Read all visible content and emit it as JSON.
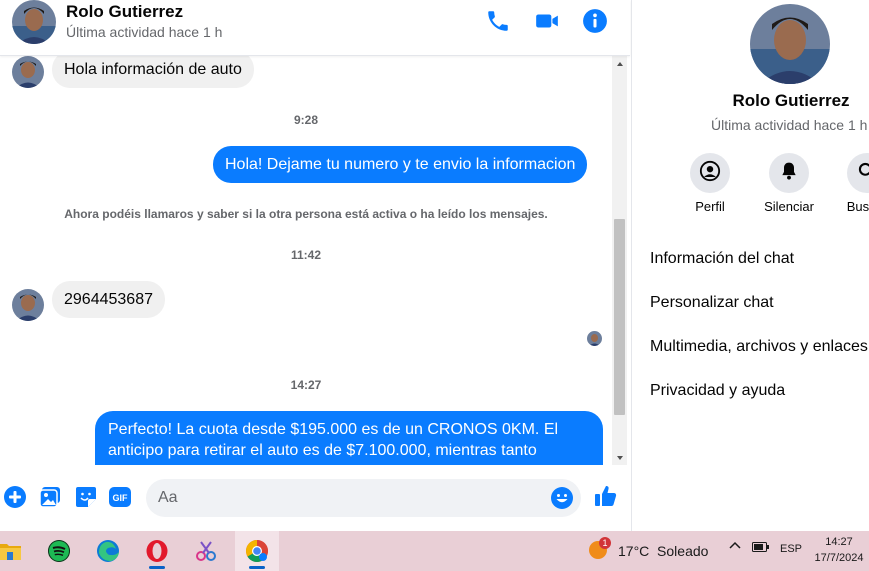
{
  "header": {
    "name": "Rolo Gutierrez",
    "status": "Última actividad hace 1 h",
    "icons": [
      "phone-icon",
      "video-camera-icon",
      "info-icon"
    ]
  },
  "messages": [
    {
      "type": "in",
      "text": "Hola información de auto"
    },
    {
      "type": "time",
      "text": "9:28"
    },
    {
      "type": "out",
      "text": "Hola! Dejame tu numero y te envio la informacion"
    },
    {
      "type": "notice",
      "text": "Ahora podéis llamaros y saber si la otra persona está activa o ha leído los mensajes."
    },
    {
      "type": "time",
      "text": "11:42"
    },
    {
      "type": "in",
      "text": "2964453687"
    },
    {
      "type": "time",
      "text": "14:27"
    },
    {
      "type": "out",
      "text": "Perfecto! La cuota desde $195.000 es de un CRONOS 0KM. El anticipo para retirar el auto es de $7.100.000, mientras tanto"
    }
  ],
  "composer": {
    "placeholder": "Aa",
    "icons": [
      "plus-icon",
      "image-icon",
      "sticker-icon",
      "gif-icon",
      "emoji-icon",
      "thumbs-up-icon"
    ],
    "gif_label": "GIF"
  },
  "panel": {
    "name": "Rolo Gutierrez",
    "status": "Última actividad hace 1 h",
    "actions": [
      {
        "label": "Perfil",
        "icon": "profile-icon"
      },
      {
        "label": "Silenciar",
        "icon": "bell-icon"
      },
      {
        "label": "Buscar",
        "icon": "search-icon"
      }
    ],
    "menu": [
      "Información del chat",
      "Personalizar chat",
      "Multimedia, archivos y enlaces",
      "Privacidad y ayuda"
    ]
  },
  "taskbar": {
    "apps": [
      "file-explorer-icon",
      "spotify-icon",
      "edge-icon",
      "opera-icon",
      "snipping-tool-icon",
      "chrome-icon"
    ],
    "weather_badge": "1",
    "weather": "17°C  Soleado",
    "language": "ESP",
    "time": "14:27",
    "date": "17/7/2024"
  },
  "colors": {
    "accent": "#0a7cff",
    "bubble_in": "#f0f0f0",
    "taskbar": "#e9cfd6"
  }
}
